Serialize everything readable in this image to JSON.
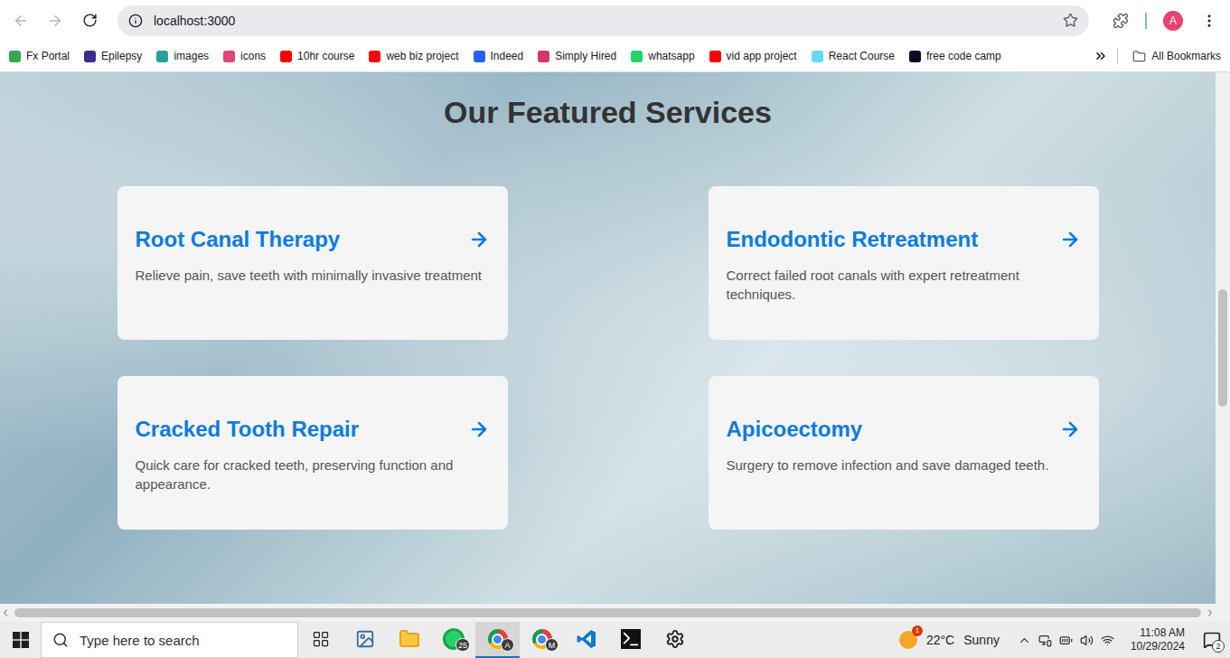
{
  "browser": {
    "url": "localhost:3000",
    "profile": "A"
  },
  "bookmarks": [
    {
      "label": "Fx Portal",
      "color": "#34a853"
    },
    {
      "label": "Epilepsy",
      "color": "#3c2a8c"
    },
    {
      "label": "images",
      "color": "#2aa198"
    },
    {
      "label": "icons",
      "color": "#e0457b"
    },
    {
      "label": "10hr course",
      "color": "#ff0000"
    },
    {
      "label": "web biz project",
      "color": "#ff0000"
    },
    {
      "label": "Indeed",
      "color": "#2164f3"
    },
    {
      "label": "Simply Hired",
      "color": "#d6336c"
    },
    {
      "label": "whatsapp",
      "color": "#25d366"
    },
    {
      "label": "vid app project",
      "color": "#ff0000"
    },
    {
      "label": "React Course",
      "color": "#61dafb"
    },
    {
      "label": "free code camp",
      "color": "#0a0a23"
    }
  ],
  "all_bookmarks": "All Bookmarks",
  "page": {
    "heading": "Our Featured Services",
    "services": [
      {
        "title": "Root Canal Therapy",
        "description": "Relieve pain, save teeth with minimally invasive treatment"
      },
      {
        "title": "Endodontic Retreatment",
        "description": "Correct failed root canals with expert retreatment techniques."
      },
      {
        "title": "Cracked Tooth Repair",
        "description": "Quick care for cracked teeth, preserving function and appearance."
      },
      {
        "title": "Apicoectomy",
        "description": "Surgery to remove infection and save damaged teeth."
      }
    ]
  },
  "taskbar": {
    "search": {
      "placeholder": "Type here to search"
    },
    "apps": [
      {
        "kind": "task-view",
        "selected": false
      },
      {
        "kind": "photos",
        "selected": false
      },
      {
        "kind": "file-explorer",
        "selected": false
      },
      {
        "kind": "whatsapp",
        "badge": "25",
        "selected": false
      },
      {
        "kind": "chrome",
        "badge": "A",
        "selected": true
      },
      {
        "kind": "chrome",
        "badge": "M",
        "selected": false
      },
      {
        "kind": "vscode",
        "selected": false
      },
      {
        "kind": "terminal",
        "selected": false
      },
      {
        "kind": "settings",
        "selected": false
      }
    ],
    "weather": {
      "temperature": "22°C",
      "condition": "Sunny",
      "badge": "1"
    },
    "clock": {
      "time": "11:08 AM",
      "date": "10/29/2024"
    },
    "notifications": "2"
  }
}
